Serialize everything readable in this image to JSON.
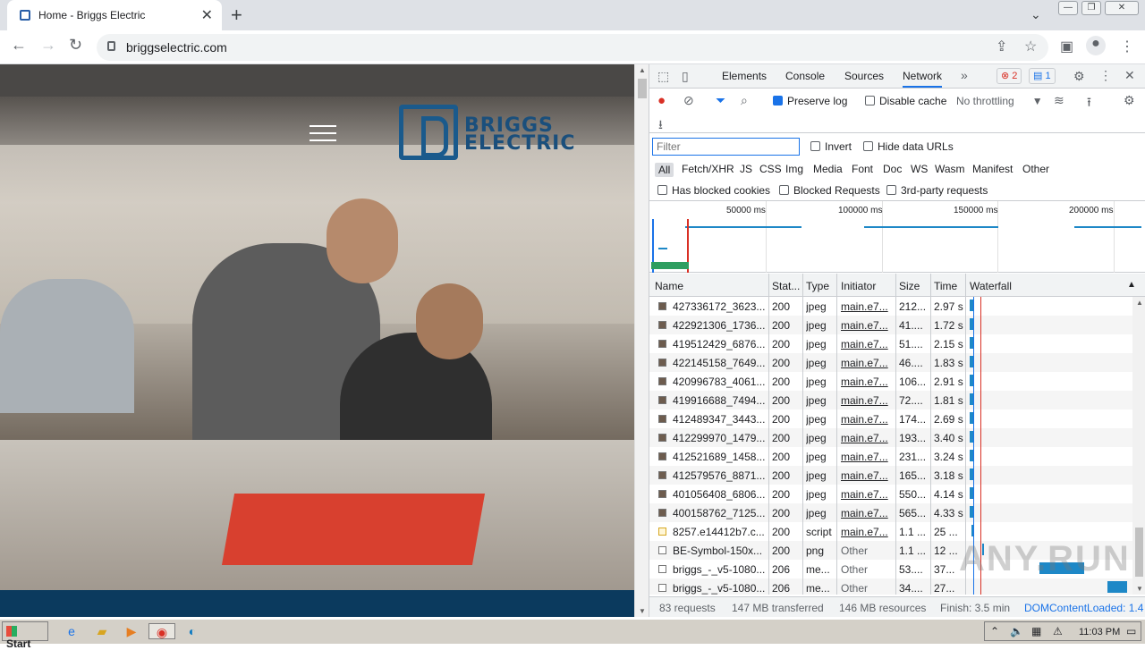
{
  "browser": {
    "tab_title": "Home - Briggs Electric",
    "url": "briggselectric.com"
  },
  "website": {
    "logo_line1": "BRIGGS",
    "logo_line2": "ELECTRIC"
  },
  "devtools": {
    "tabs": [
      "Elements",
      "Console",
      "Sources",
      "Network"
    ],
    "active_tab": "Network",
    "error_count": "2",
    "message_count": "1",
    "toolbar": {
      "preserve_log": "Preserve log",
      "disable_cache": "Disable cache",
      "throttling": "No throttling"
    },
    "filter": {
      "placeholder": "Filter",
      "invert": "Invert",
      "hide_data_urls": "Hide data URLs",
      "types": [
        "All",
        "Fetch/XHR",
        "JS",
        "CSS",
        "Img",
        "Media",
        "Font",
        "Doc",
        "WS",
        "Wasm",
        "Manifest",
        "Other"
      ],
      "has_blocked_cookies": "Has blocked cookies",
      "blocked_requests": "Blocked Requests",
      "third_party": "3rd-party requests"
    },
    "overview_labels": [
      "50000 ms",
      "100000 ms",
      "150000 ms",
      "200000 ms"
    ],
    "columns": [
      "Name",
      "Stat...",
      "Type",
      "Initiator",
      "Size",
      "Time",
      "Waterfall"
    ],
    "rows": [
      {
        "name": "427336172_3623...",
        "status": "200",
        "type": "jpeg",
        "initiator": "main.e7...",
        "size": "212...",
        "time": "2.97 s",
        "icon": "img"
      },
      {
        "name": "422921306_1736...",
        "status": "200",
        "type": "jpeg",
        "initiator": "main.e7...",
        "size": "41....",
        "time": "1.72 s",
        "icon": "img"
      },
      {
        "name": "419512429_6876...",
        "status": "200",
        "type": "jpeg",
        "initiator": "main.e7...",
        "size": "51....",
        "time": "2.15 s",
        "icon": "img"
      },
      {
        "name": "422145158_7649...",
        "status": "200",
        "type": "jpeg",
        "initiator": "main.e7...",
        "size": "46....",
        "time": "1.83 s",
        "icon": "img"
      },
      {
        "name": "420996783_4061...",
        "status": "200",
        "type": "jpeg",
        "initiator": "main.e7...",
        "size": "106...",
        "time": "2.91 s",
        "icon": "img"
      },
      {
        "name": "419916688_7494...",
        "status": "200",
        "type": "jpeg",
        "initiator": "main.e7...",
        "size": "72....",
        "time": "1.81 s",
        "icon": "img"
      },
      {
        "name": "412489347_3443...",
        "status": "200",
        "type": "jpeg",
        "initiator": "main.e7...",
        "size": "174...",
        "time": "2.69 s",
        "icon": "img"
      },
      {
        "name": "412299970_1479...",
        "status": "200",
        "type": "jpeg",
        "initiator": "main.e7...",
        "size": "193...",
        "time": "3.40 s",
        "icon": "img"
      },
      {
        "name": "412521689_1458...",
        "status": "200",
        "type": "jpeg",
        "initiator": "main.e7...",
        "size": "231...",
        "time": "3.24 s",
        "icon": "img"
      },
      {
        "name": "412579576_8871...",
        "status": "200",
        "type": "jpeg",
        "initiator": "main.e7...",
        "size": "165...",
        "time": "3.18 s",
        "icon": "img"
      },
      {
        "name": "401056408_6806...",
        "status": "200",
        "type": "jpeg",
        "initiator": "main.e7...",
        "size": "550...",
        "time": "4.14 s",
        "icon": "img"
      },
      {
        "name": "400158762_7125...",
        "status": "200",
        "type": "jpeg",
        "initiator": "main.e7...",
        "size": "565...",
        "time": "4.33 s",
        "icon": "img"
      },
      {
        "name": "8257.e14412b7.c...",
        "status": "200",
        "type": "script",
        "initiator": "main.e7...",
        "size": "1.1 ...",
        "time": "25 ...",
        "icon": "script"
      },
      {
        "name": "BE-Symbol-150x...",
        "status": "200",
        "type": "png",
        "initiator": "Other",
        "size": "1.1 ...",
        "time": "12 ...",
        "icon": "doc"
      },
      {
        "name": "briggs_-_v5-1080...",
        "status": "206",
        "type": "me...",
        "initiator": "Other",
        "size": "53....",
        "time": "37...",
        "icon": "doc"
      },
      {
        "name": "briggs_-_v5-1080...",
        "status": "206",
        "type": "me...",
        "initiator": "Other",
        "size": "34....",
        "time": "27...",
        "icon": "doc"
      }
    ],
    "status": {
      "requests": "83 requests",
      "transferred": "147 MB transferred",
      "resources": "146 MB resources",
      "finish": "Finish: 3.5 min",
      "dcl": "DOMContentLoaded: 1.4"
    }
  },
  "taskbar": {
    "start": "Start",
    "clock": "11:03 PM"
  },
  "watermark": "ANY.RUN"
}
